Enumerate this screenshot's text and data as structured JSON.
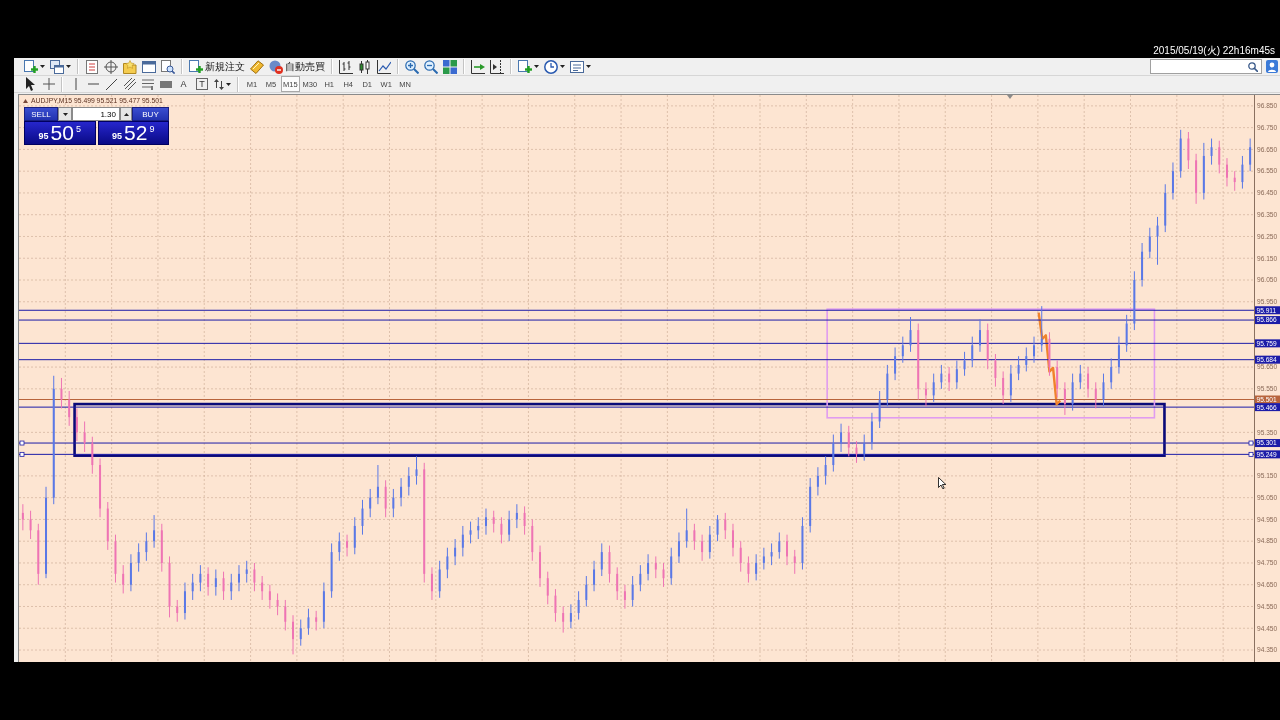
{
  "timestamp": "2015/05/19(火) 22h16m45s",
  "toolbar": {
    "buttons": [
      {
        "kind": "new-order",
        "label": "新規注文"
      },
      {
        "kind": "auto-trading",
        "label": "自動売買"
      }
    ],
    "drawing_tools": [
      {
        "kind": "text",
        "label": "A"
      },
      {
        "kind": "label",
        "label": "T"
      }
    ],
    "timeframes": [
      {
        "label": "M1",
        "selected": false
      },
      {
        "label": "M5",
        "selected": false
      },
      {
        "label": "M15",
        "selected": true
      },
      {
        "label": "M30",
        "selected": false
      },
      {
        "label": "H1",
        "selected": false
      },
      {
        "label": "H4",
        "selected": false
      },
      {
        "label": "D1",
        "selected": false
      },
      {
        "label": "W1",
        "selected": false
      },
      {
        "label": "MN",
        "selected": false
      }
    ]
  },
  "chart": {
    "header": "AUDJPY,M15 95.499 95.521 95.477 95.501",
    "one_click": {
      "sell": {
        "label": "SELL",
        "big_figure": "95",
        "pips": "50",
        "point": "5"
      },
      "lots": "1.30",
      "buy": {
        "label": "BUY",
        "big_figure": "95",
        "pips": "52",
        "point": "9"
      }
    },
    "drawn_objects": [
      {
        "kind": "rectangle",
        "color": "#0a0a78"
      },
      {
        "kind": "rectangle",
        "color": "#e09cf0"
      },
      {
        "kind": "marker-stroke",
        "color": "#f0822a"
      }
    ],
    "price_lines": [
      {
        "selected": false
      },
      {
        "selected": false
      },
      {
        "selected": false
      },
      {
        "selected": false
      },
      {
        "selected": false
      },
      {
        "selected": false
      },
      {
        "selected": true
      },
      {
        "selected": true
      }
    ],
    "chart_data": [
      {
        "type": "candlestick",
        "tick_labels": "y",
        "grid": true,
        "ylim": [
          94.295,
          96.9
        ],
        "yticks": [
          {
            "value": 94.35,
            "label": "94.350"
          },
          {
            "value": 94.45,
            "label": "94.450"
          },
          {
            "value": 94.55,
            "label": "94.550"
          },
          {
            "value": 94.65,
            "label": "94.650"
          },
          {
            "value": 94.75,
            "label": "94.750"
          },
          {
            "value": 94.85,
            "label": "94.850"
          },
          {
            "value": 94.95,
            "label": "94.950"
          },
          {
            "value": 95.05,
            "label": "95.050"
          },
          {
            "value": 95.15,
            "label": "95.150"
          },
          {
            "value": 95.35,
            "label": "95.350"
          },
          {
            "value": 95.55,
            "label": "95.550"
          },
          {
            "value": 95.65,
            "label": "95.650"
          },
          {
            "value": 95.95,
            "label": "95.950"
          },
          {
            "value": 96.05,
            "label": "96.050"
          },
          {
            "value": 96.15,
            "label": "96.150"
          },
          {
            "value": 96.25,
            "label": "96.250"
          },
          {
            "value": 96.35,
            "label": "96.350"
          },
          {
            "value": 96.45,
            "label": "96.450"
          },
          {
            "value": 96.55,
            "label": "96.550"
          },
          {
            "value": 96.65,
            "label": "96.650"
          },
          {
            "value": 96.75,
            "label": "96.750"
          },
          {
            "value": 96.85,
            "label": "96.850"
          }
        ],
        "ohlc": [
          [
            94.98,
            95.02,
            94.9,
            94.95
          ],
          [
            94.95,
            94.99,
            94.86,
            94.9
          ],
          [
            94.9,
            94.93,
            94.65,
            94.7
          ],
          [
            94.7,
            95.1,
            94.68,
            95.05
          ],
          [
            95.05,
            95.61,
            95.02,
            95.55
          ],
          [
            95.55,
            95.6,
            95.46,
            95.5
          ],
          [
            95.5,
            95.54,
            95.38,
            95.42
          ],
          [
            95.42,
            95.46,
            95.31,
            95.35
          ],
          [
            95.35,
            95.4,
            95.26,
            95.3
          ],
          [
            95.3,
            95.33,
            95.16,
            95.2
          ],
          [
            95.2,
            95.23,
            94.96,
            95.0
          ],
          [
            95.0,
            95.03,
            94.81,
            94.85
          ],
          [
            94.85,
            94.88,
            94.66,
            94.7
          ],
          [
            94.7,
            94.74,
            94.61,
            94.65
          ],
          [
            94.65,
            94.79,
            94.62,
            94.75
          ],
          [
            94.75,
            94.84,
            94.71,
            94.8
          ],
          [
            94.8,
            94.89,
            94.76,
            94.85
          ],
          [
            94.85,
            94.97,
            94.82,
            94.9
          ],
          [
            94.9,
            94.93,
            94.71,
            94.75
          ],
          [
            94.75,
            94.78,
            94.5,
            94.55
          ],
          [
            94.55,
            94.58,
            94.48,
            94.52
          ],
          [
            94.52,
            94.66,
            94.49,
            94.62
          ],
          [
            94.62,
            94.7,
            94.58,
            94.66
          ],
          [
            94.66,
            94.74,
            94.62,
            94.7
          ],
          [
            94.7,
            94.73,
            94.6,
            94.64
          ],
          [
            94.64,
            94.72,
            94.6,
            94.68
          ],
          [
            94.68,
            94.71,
            94.58,
            94.62
          ],
          [
            94.62,
            94.7,
            94.58,
            94.66
          ],
          [
            94.66,
            94.74,
            94.62,
            94.7
          ],
          [
            94.7,
            94.76,
            94.66,
            94.72
          ],
          [
            94.72,
            94.75,
            94.62,
            94.66
          ],
          [
            94.66,
            94.69,
            94.58,
            94.62
          ],
          [
            94.62,
            94.65,
            94.54,
            94.58
          ],
          [
            94.58,
            94.61,
            94.51,
            94.55
          ],
          [
            94.55,
            94.58,
            94.44,
            94.48
          ],
          [
            94.48,
            94.51,
            94.33,
            94.4
          ],
          [
            94.4,
            94.49,
            94.37,
            94.45
          ],
          [
            94.45,
            94.54,
            94.42,
            94.5
          ],
          [
            94.5,
            94.53,
            94.44,
            94.48
          ],
          [
            94.48,
            94.66,
            94.45,
            94.62
          ],
          [
            94.62,
            94.84,
            94.59,
            94.8
          ],
          [
            94.8,
            94.89,
            94.76,
            94.85
          ],
          [
            94.85,
            94.88,
            94.78,
            94.82
          ],
          [
            94.82,
            94.96,
            94.79,
            94.92
          ],
          [
            94.92,
            95.04,
            94.88,
            95.0
          ],
          [
            95.0,
            95.09,
            94.96,
            95.05
          ],
          [
            95.05,
            95.2,
            95.02,
            95.1
          ],
          [
            95.1,
            95.13,
            94.96,
            95.0
          ],
          [
            95.0,
            95.09,
            94.96,
            95.05
          ],
          [
            95.05,
            95.14,
            95.01,
            95.1
          ],
          [
            95.1,
            95.19,
            95.06,
            95.15
          ],
          [
            95.15,
            95.24,
            95.11,
            95.18
          ],
          [
            95.18,
            95.21,
            94.66,
            94.7
          ],
          [
            94.7,
            94.73,
            94.58,
            94.62
          ],
          [
            94.62,
            94.76,
            94.59,
            94.72
          ],
          [
            94.72,
            94.82,
            94.68,
            94.78
          ],
          [
            94.78,
            94.86,
            94.74,
            94.82
          ],
          [
            94.82,
            94.92,
            94.78,
            94.88
          ],
          [
            94.88,
            94.94,
            94.84,
            94.9
          ],
          [
            94.9,
            94.96,
            94.86,
            94.92
          ],
          [
            94.92,
            95.0,
            94.88,
            94.96
          ],
          [
            94.96,
            94.99,
            94.89,
            94.93
          ],
          [
            94.93,
            94.96,
            94.84,
            94.88
          ],
          [
            94.88,
            94.99,
            94.85,
            94.95
          ],
          [
            94.95,
            95.02,
            94.91,
            94.98
          ],
          [
            94.98,
            95.01,
            94.88,
            94.92
          ],
          [
            94.92,
            94.95,
            94.76,
            94.8
          ],
          [
            94.8,
            94.83,
            94.64,
            94.68
          ],
          [
            94.68,
            94.71,
            94.56,
            94.6
          ],
          [
            94.6,
            94.63,
            94.48,
            94.52
          ],
          [
            94.52,
            94.55,
            94.43,
            94.48
          ],
          [
            94.48,
            94.56,
            94.45,
            94.52
          ],
          [
            94.52,
            94.62,
            94.49,
            94.58
          ],
          [
            94.58,
            94.69,
            94.55,
            94.65
          ],
          [
            94.65,
            94.76,
            94.62,
            94.72
          ],
          [
            94.72,
            94.84,
            94.69,
            94.8
          ],
          [
            94.8,
            94.83,
            94.66,
            94.7
          ],
          [
            94.7,
            94.73,
            94.58,
            94.62
          ],
          [
            94.62,
            94.65,
            94.54,
            94.58
          ],
          [
            94.58,
            94.69,
            94.55,
            94.65
          ],
          [
            94.65,
            94.74,
            94.62,
            94.7
          ],
          [
            94.7,
            94.79,
            94.67,
            94.75
          ],
          [
            94.75,
            94.78,
            94.68,
            94.72
          ],
          [
            94.72,
            94.75,
            94.64,
            94.68
          ],
          [
            94.68,
            94.82,
            94.65,
            94.78
          ],
          [
            94.78,
            94.89,
            94.75,
            94.85
          ],
          [
            94.85,
            95.0,
            94.82,
            94.9
          ],
          [
            94.9,
            94.93,
            94.81,
            94.85
          ],
          [
            94.85,
            94.88,
            94.76,
            94.8
          ],
          [
            94.8,
            94.92,
            94.77,
            94.88
          ],
          [
            94.88,
            94.97,
            94.85,
            94.95
          ],
          [
            94.95,
            94.98,
            94.86,
            94.9
          ],
          [
            94.9,
            94.93,
            94.78,
            94.82
          ],
          [
            94.82,
            94.85,
            94.71,
            94.75
          ],
          [
            94.75,
            94.78,
            94.66,
            94.7
          ],
          [
            94.7,
            94.79,
            94.67,
            94.75
          ],
          [
            94.75,
            94.82,
            94.72,
            94.78
          ],
          [
            94.78,
            94.84,
            94.74,
            94.8
          ],
          [
            94.8,
            94.89,
            94.77,
            94.85
          ],
          [
            94.85,
            94.88,
            94.74,
            94.78
          ],
          [
            94.78,
            94.81,
            94.7,
            94.75
          ],
          [
            94.75,
            94.96,
            94.72,
            94.92
          ],
          [
            94.92,
            95.14,
            94.89,
            95.1
          ],
          [
            95.1,
            95.19,
            95.06,
            95.15
          ],
          [
            95.15,
            95.24,
            95.11,
            95.2
          ],
          [
            95.2,
            95.34,
            95.17,
            95.3
          ],
          [
            95.3,
            95.39,
            95.26,
            95.35
          ],
          [
            95.35,
            95.38,
            95.24,
            95.28
          ],
          [
            95.28,
            95.31,
            95.21,
            95.25
          ],
          [
            95.25,
            95.34,
            95.22,
            95.3
          ],
          [
            95.3,
            95.44,
            95.27,
            95.4
          ],
          [
            95.4,
            95.54,
            95.37,
            95.5
          ],
          [
            95.5,
            95.66,
            95.47,
            95.62
          ],
          [
            95.62,
            95.74,
            95.59,
            95.7
          ],
          [
            95.7,
            95.79,
            95.67,
            95.75
          ],
          [
            95.75,
            95.88,
            95.72,
            95.82
          ],
          [
            95.82,
            95.85,
            95.5,
            95.55
          ],
          [
            95.55,
            95.58,
            95.47,
            95.52
          ],
          [
            95.52,
            95.62,
            95.49,
            95.58
          ],
          [
            95.58,
            95.66,
            95.55,
            95.62
          ],
          [
            95.62,
            95.65,
            95.54,
            95.58
          ],
          [
            95.58,
            95.68,
            95.55,
            95.64
          ],
          [
            95.64,
            95.72,
            95.61,
            95.68
          ],
          [
            95.68,
            95.79,
            95.65,
            95.75
          ],
          [
            95.75,
            95.87,
            95.72,
            95.82
          ],
          [
            95.82,
            95.85,
            95.64,
            95.68
          ],
          [
            95.68,
            95.71,
            95.56,
            95.6
          ],
          [
            95.6,
            95.63,
            95.48,
            95.52
          ],
          [
            95.52,
            95.66,
            95.49,
            95.62
          ],
          [
            95.62,
            95.7,
            95.59,
            95.66
          ],
          [
            95.66,
            95.74,
            95.63,
            95.7
          ],
          [
            95.7,
            95.79,
            95.67,
            95.75
          ],
          [
            95.75,
            95.93,
            95.72,
            95.78
          ],
          [
            95.78,
            95.81,
            95.61,
            95.65
          ],
          [
            95.65,
            95.68,
            95.51,
            95.55
          ],
          [
            95.55,
            95.58,
            95.43,
            95.48
          ],
          [
            95.48,
            95.62,
            95.45,
            95.58
          ],
          [
            95.58,
            95.66,
            95.55,
            95.62
          ],
          [
            95.62,
            95.65,
            95.51,
            95.55
          ],
          [
            95.55,
            95.58,
            95.46,
            95.5
          ],
          [
            95.5,
            95.62,
            95.47,
            95.58
          ],
          [
            95.58,
            95.69,
            95.55,
            95.65
          ],
          [
            95.65,
            95.79,
            95.62,
            95.75
          ],
          [
            95.75,
            95.89,
            95.72,
            95.85
          ],
          [
            95.85,
            96.09,
            95.82,
            96.05
          ],
          [
            96.05,
            96.22,
            96.02,
            96.18
          ],
          [
            96.18,
            96.29,
            96.15,
            96.25
          ],
          [
            96.25,
            96.34,
            96.12,
            96.3
          ],
          [
            96.3,
            96.49,
            96.27,
            96.45
          ],
          [
            96.45,
            96.59,
            96.42,
            96.55
          ],
          [
            96.55,
            96.74,
            96.52,
            96.7
          ],
          [
            96.7,
            96.73,
            96.56,
            96.6
          ],
          [
            96.6,
            96.63,
            96.4,
            96.45
          ],
          [
            96.45,
            96.68,
            96.42,
            96.62
          ],
          [
            96.62,
            96.7,
            96.58,
            96.66
          ],
          [
            96.66,
            96.69,
            96.54,
            96.58
          ],
          [
            96.58,
            96.61,
            96.48,
            96.52
          ],
          [
            96.52,
            96.55,
            96.46,
            96.5
          ],
          [
            96.5,
            96.62,
            96.47,
            96.58
          ],
          [
            96.58,
            96.7,
            96.55,
            96.66
          ]
        ],
        "ref_lines": [
          {
            "axis": "y",
            "value": 95.911,
            "label": "95.911",
            "color": "#1c1ca8"
          },
          {
            "axis": "y",
            "value": 95.866,
            "label": "95.866",
            "color": "#1c1ca8"
          },
          {
            "axis": "y",
            "value": 95.759,
            "label": "95.759",
            "color": "#1c1ca8"
          },
          {
            "axis": "y",
            "value": 95.684,
            "label": "95.684",
            "color": "#1c1ca8"
          },
          {
            "axis": "y",
            "value": 95.501,
            "label": "95.501",
            "color": "#b8643c"
          },
          {
            "axis": "y",
            "value": 95.466,
            "label": "95.466",
            "color": "#1c1ca8"
          },
          {
            "axis": "y",
            "value": 95.301,
            "label": "95.301",
            "color": "#1c1ca8"
          },
          {
            "axis": "y",
            "value": 95.249,
            "label": "95.249",
            "color": "#1c1ca8"
          }
        ]
      }
    ]
  }
}
